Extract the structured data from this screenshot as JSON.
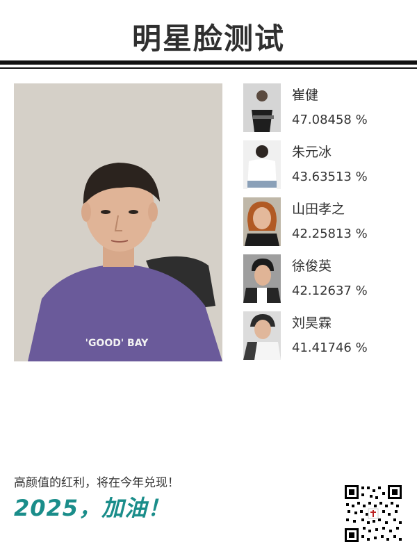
{
  "header": {
    "title": "明星脸测试"
  },
  "user_photo": {
    "shirt_text": "'GOOD' BAY"
  },
  "matches": [
    {
      "name": "崔健",
      "score": "47.08458 %"
    },
    {
      "name": "朱元冰",
      "score": "43.63513 %"
    },
    {
      "name": "山田孝之",
      "score": "42.25813 %"
    },
    {
      "name": "徐俊英",
      "score": "42.12637 %"
    },
    {
      "name": "刘昊霖",
      "score": "41.41746 %"
    }
  ],
  "footer": {
    "caption": "高颜值的红利，将在今年兑现！",
    "slogan": "2025，加油！"
  },
  "colors": {
    "accent": "#1a8d8a",
    "rule": "#111111",
    "shirt": "#6a5a9a"
  }
}
